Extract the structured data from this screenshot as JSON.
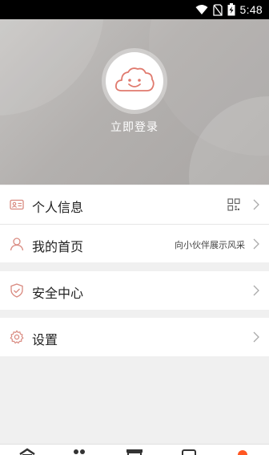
{
  "status_bar": {
    "time": "5:48",
    "icons": [
      "wifi-icon",
      "no-sim-icon",
      "battery-charging-icon"
    ]
  },
  "header": {
    "avatar_icon": "cloud-smile-icon",
    "login_label": "立即登录"
  },
  "menu": {
    "group1": [
      {
        "label": "个人信息",
        "icon": "id-card-icon",
        "trailing_icon": "qr-code-icon"
      },
      {
        "label": "我的首页",
        "icon": "user-icon",
        "subtitle": "向小伙伴展示风采"
      }
    ],
    "group2": [
      {
        "label": "安全中心",
        "icon": "shield-check-icon"
      }
    ],
    "group3": [
      {
        "label": "设置",
        "icon": "gear-icon"
      }
    ]
  },
  "bottom_nav": {
    "items": [
      "home-icon",
      "friends-icon",
      "store-icon",
      "cards-icon",
      "profile-icon"
    ],
    "active_color": "#ff5722"
  },
  "colors": {
    "accent": "#e07a6e",
    "icon_outline": "#d98a80"
  }
}
